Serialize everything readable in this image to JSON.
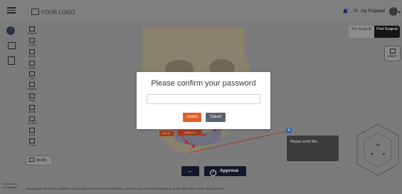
{
  "header": {
    "logo_text": "YOUR LOGO",
    "user_name": "Dr. Jay Prajapati",
    "notification_count": "3"
  },
  "tools": [
    {
      "label": "3d Home"
    },
    {
      "label": "Control"
    },
    {
      "label": "Isolate"
    },
    {
      "label": "Plane"
    },
    {
      "label": "Cut"
    },
    {
      "label": "Distance"
    },
    {
      "label": "Angle"
    },
    {
      "label": "Spline"
    },
    {
      "label": "3D View"
    },
    {
      "label": "Load"
    },
    {
      "label": "X-Ray"
    }
  ],
  "modify_label": "Modify",
  "view_toggle": {
    "pre_label": "Pre Surgical",
    "post_label": "Post Surgical",
    "selected": "post"
  },
  "object_label": "Object",
  "annotation": {
    "badge": "A",
    "text": "Please verify this.",
    "tag_1": "112.3°",
    "tag_2": "Cutline 1"
  },
  "actions": {
    "back_label": "←",
    "approve_label": "Approve"
  },
  "footer_text": "3dsurgical's 3d Viewer platform is pending CE and FDA certification. Current use in clinical settings is at the discretion of the clinical team.",
  "powered_by": "Powered by",
  "powered_brand": "3d Surgical",
  "modal": {
    "title": "Please confirm your password",
    "password_value": "",
    "password_placeholder": "",
    "submit_label": "Submit",
    "cancel_label": "Cancel"
  },
  "colors": {
    "submit": "#e06026",
    "cancel": "#5d6370",
    "approve_bg": "#12182a",
    "overlay": "#7b7b7b"
  }
}
